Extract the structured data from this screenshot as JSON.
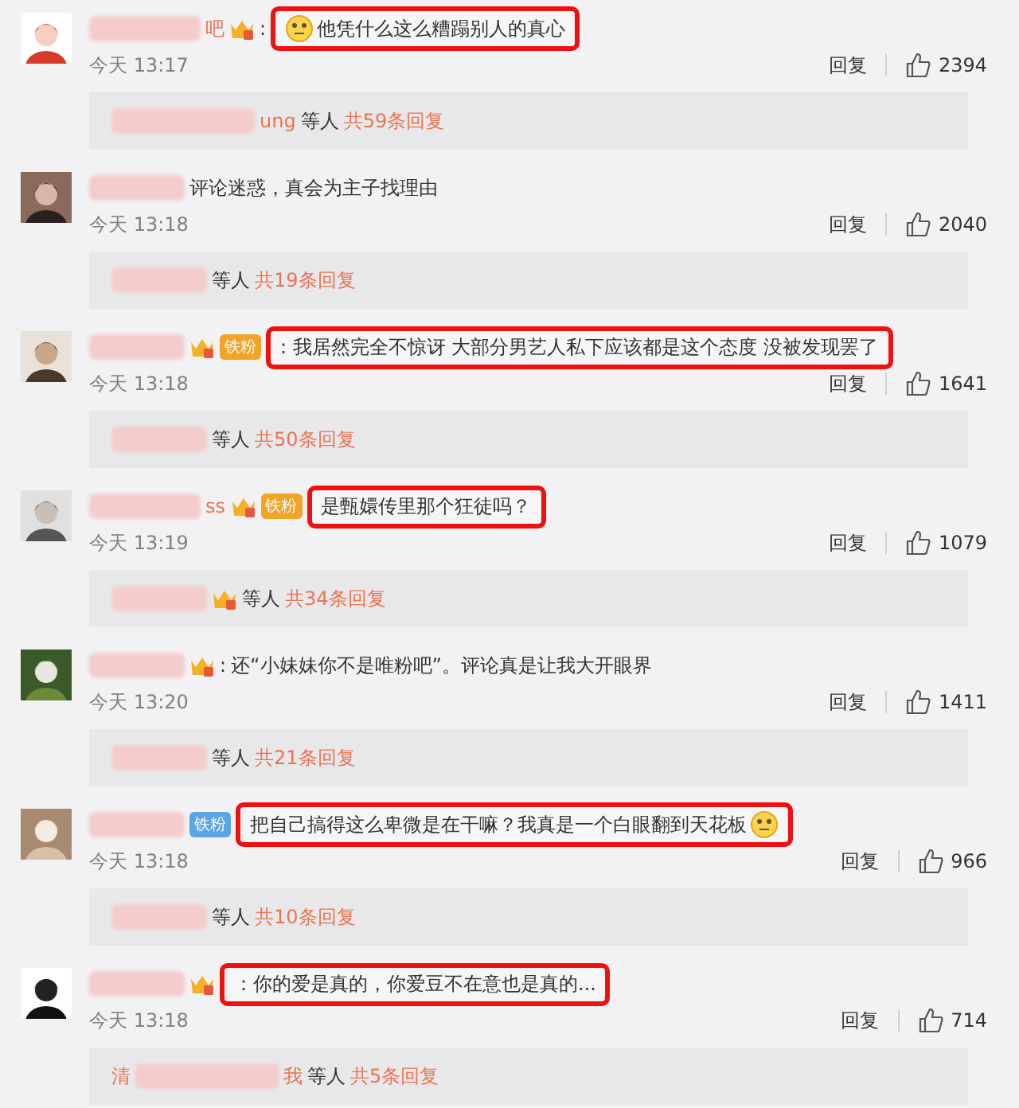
{
  "comments": [
    {
      "avatar": {
        "kind": "picture"
      },
      "name_after": "吧",
      "badges": [
        {
          "kind": "vip"
        }
      ],
      "colon": ":",
      "highlighted": true,
      "leading_emoji": true,
      "trailing_emoji": false,
      "text": "他凭什么这么糟蹋别人的真心",
      "time": "今天 13:17",
      "reply_label": "回复",
      "likes": "2394",
      "thread": {
        "name_after": "ung",
        "vip": false,
        "others": "等人",
        "count": "共59条回复"
      }
    },
    {
      "avatar": {
        "kind": "picture"
      },
      "highlighted": false,
      "leading_emoji": false,
      "trailing_emoji": false,
      "text": "评论迷惑，真会为主子找理由",
      "time": "今天 13:18",
      "reply_label": "回复",
      "likes": "2040",
      "thread": {
        "vip": false,
        "others": "等人",
        "count": "共19条回复"
      }
    },
    {
      "avatar": {
        "kind": "picture"
      },
      "badges": [
        {
          "kind": "vip"
        },
        {
          "kind": "fan",
          "label": "铁粉",
          "color": "#f2a427"
        }
      ],
      "highlighted": true,
      "leading_emoji": false,
      "trailing_emoji": false,
      "text": ": 我居然完全不惊讶 大部分男艺人私下应该都是这个态度 没被发现罢了",
      "time": "今天 13:18",
      "reply_label": "回复",
      "likes": "1641",
      "thread": {
        "vip": false,
        "others": "等人",
        "count": "共50条回复"
      }
    },
    {
      "avatar": {
        "kind": "picture"
      },
      "name_after": "ss",
      "badges": [
        {
          "kind": "vip"
        },
        {
          "kind": "fan",
          "label": "铁粉",
          "color": "#f2a427"
        }
      ],
      "highlighted": true,
      "leading_emoji": false,
      "trailing_emoji": false,
      "text": "是甄嬛传里那个狂徒吗？",
      "time": "今天 13:19",
      "reply_label": "回复",
      "likes": "1079",
      "thread": {
        "vip": true,
        "others": "等人",
        "count": "共34条回复"
      }
    },
    {
      "avatar": {
        "kind": "picture"
      },
      "badges": [
        {
          "kind": "vip"
        }
      ],
      "colon": ":",
      "highlighted": false,
      "leading_emoji": false,
      "trailing_emoji": false,
      "text": "还“小妹妹你不是唯粉吧”。评论真是让我大开眼界",
      "time": "今天 13:20",
      "reply_label": "回复",
      "likes": "1411",
      "thread": {
        "vip": false,
        "others": "等人",
        "count": "共21条回复"
      }
    },
    {
      "avatar": {
        "kind": "picture"
      },
      "badges": [
        {
          "kind": "fan",
          "label": "铁粉",
          "color": "#5aa5e6"
        }
      ],
      "highlighted": true,
      "leading_emoji": false,
      "trailing_emoji": true,
      "text": "把自己搞得这么卑微是在干嘛？我真是一个白眼翻到天花板",
      "time": "今天 13:18",
      "reply_label": "回复",
      "likes": "966",
      "thread": {
        "vip": false,
        "others": "等人",
        "count": "共10条回复"
      }
    },
    {
      "avatar": {
        "kind": "picture"
      },
      "badges": [
        {
          "kind": "vip"
        }
      ],
      "highlighted": true,
      "leading_emoji": false,
      "trailing_emoji": false,
      "text": "：你的爱是真的，你爱豆不在意也是真的...",
      "time": "今天 13:18",
      "reply_label": "回复",
      "likes": "714",
      "thread": {
        "name_before": "清",
        "name_after": "我",
        "vip": false,
        "others": "等人",
        "count": "共5条回复"
      }
    }
  ]
}
